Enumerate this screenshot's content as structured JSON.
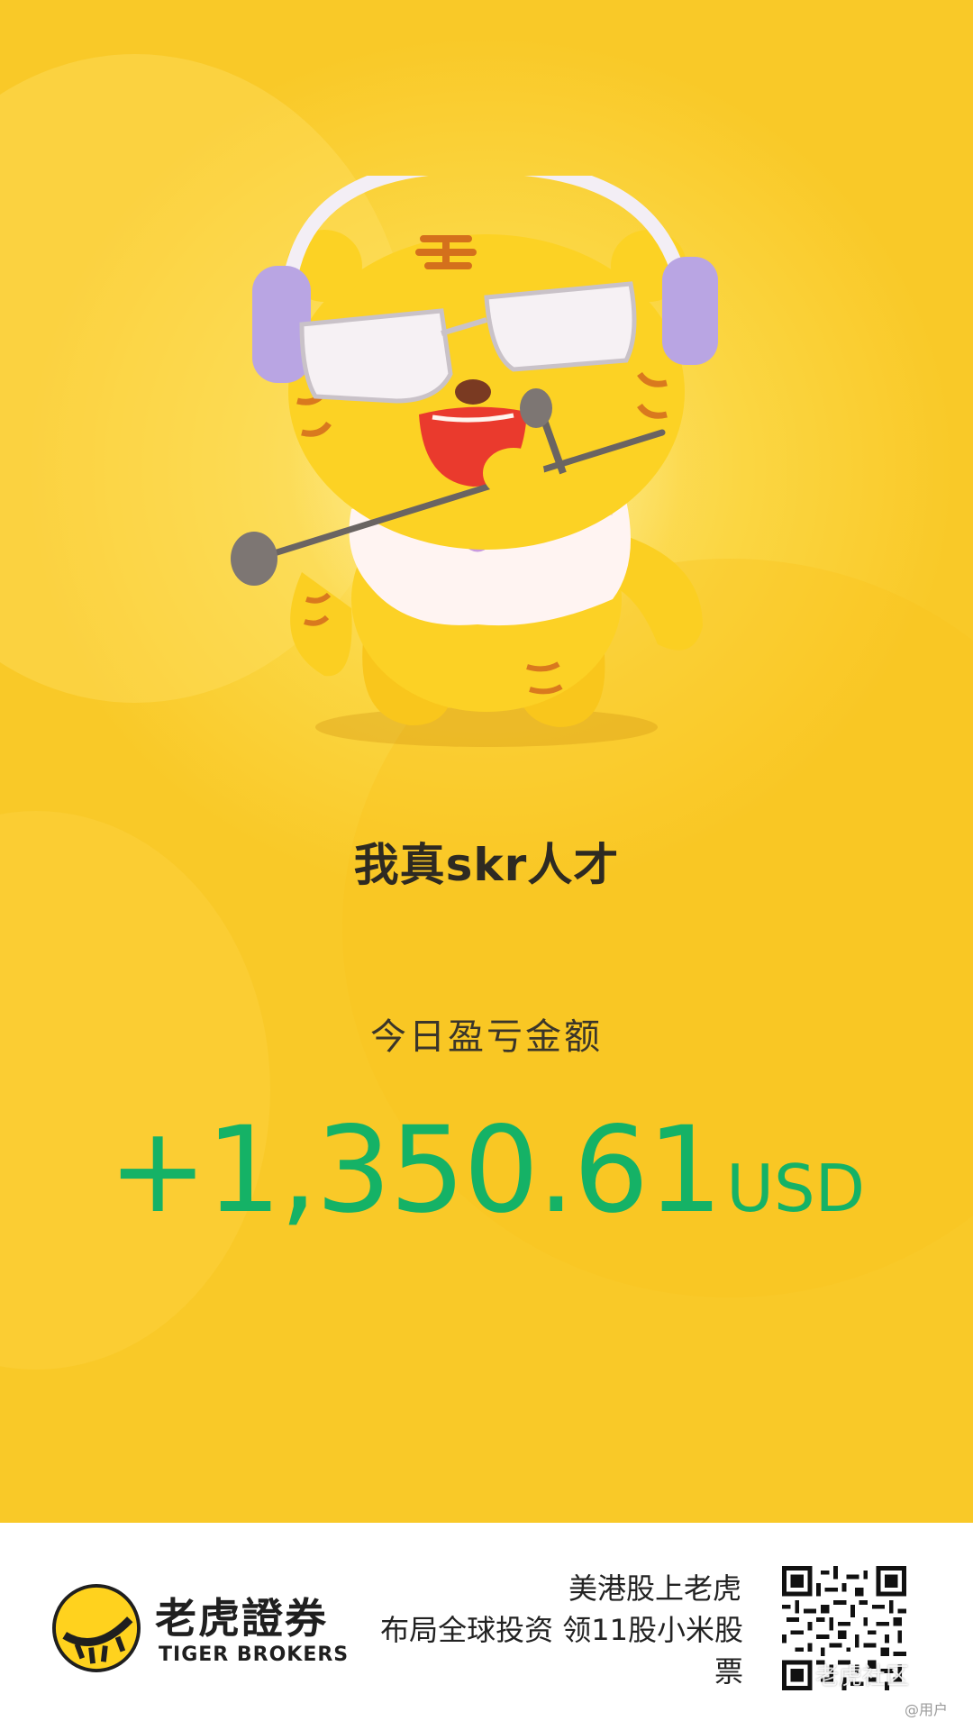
{
  "poster": {
    "title": "我真skr人才",
    "pnl_label": "今日盈亏金额",
    "pnl_value": "+1,350.61",
    "pnl_currency": "USD",
    "pnl_color": "#15b266",
    "mascot_icon": "tiger-mascot-with-headphones-and-microphone"
  },
  "footer": {
    "brand_cn": "老虎證券",
    "brand_en": "TIGER BROKERS",
    "logo_icon": "tiger-brokers-logo",
    "slogan_line1": "美港股上老虎",
    "slogan_line2": "布局全球投资 领11股小米股",
    "slogan_line3": "票",
    "qr_icon": "qr-code",
    "watermark": "老虎社区",
    "watermark_user": "@用户"
  },
  "colors": {
    "background_yellow": "#fbd642",
    "accent_green": "#15b266"
  }
}
